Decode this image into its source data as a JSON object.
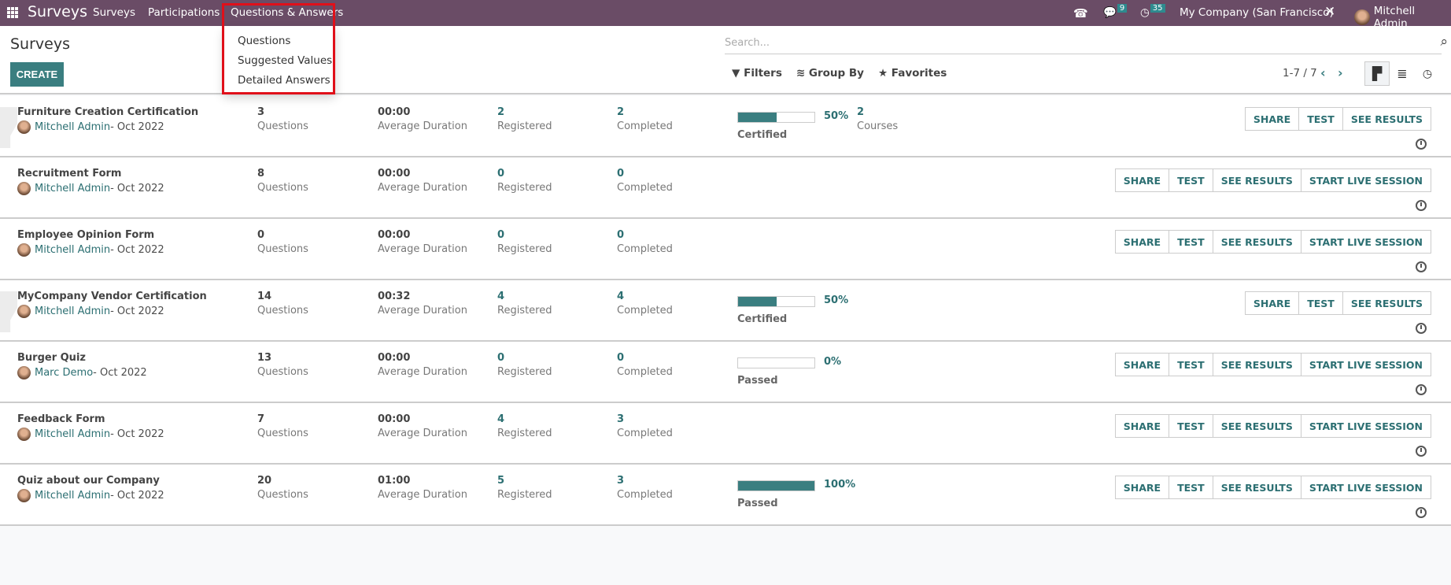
{
  "navbar": {
    "app_title": "Surveys",
    "menus": [
      "Surveys",
      "Participations",
      "Questions & Answers"
    ],
    "messages_count": "9",
    "activities_count": "35",
    "company": "My Company (San Francisco)",
    "user": "Mitchell Admin"
  },
  "dropdown": {
    "items": [
      "Questions",
      "Suggested Values",
      "Detailed Answers"
    ]
  },
  "control": {
    "title": "Surveys",
    "create_label": "CREATE",
    "search_placeholder": "Search...",
    "filters": "Filters",
    "group_by": "Group By",
    "favorites": "Favorites",
    "pager": "1-7 / 7"
  },
  "labels": {
    "questions": "Questions",
    "duration": "Average Duration",
    "registered": "Registered",
    "completed": "Completed",
    "courses": "Courses",
    "share": "SHARE",
    "test": "TEST",
    "see_results": "SEE RESULTS",
    "live": "START LIVE SESSION"
  },
  "accent": "#3a7e80",
  "surveys": [
    {
      "name": "Furniture Creation Certification",
      "owner": "Mitchell Admin",
      "date": " - Oct 2022",
      "questions": "3",
      "duration": "00:00",
      "registered": "2",
      "completed": "2",
      "progress": 50,
      "progress_label": "50%",
      "progress_type": "Certified",
      "courses": "2",
      "live": false,
      "ghost": true
    },
    {
      "name": "Recruitment Form",
      "owner": "Mitchell Admin",
      "date": " - Oct 2022",
      "questions": "8",
      "duration": "00:00",
      "registered": "0",
      "completed": "0",
      "live": true
    },
    {
      "name": "Employee Opinion Form",
      "owner": "Mitchell Admin",
      "date": " - Oct 2022",
      "questions": "0",
      "duration": "00:00",
      "registered": "0",
      "completed": "0",
      "live": true
    },
    {
      "name": "MyCompany Vendor Certification",
      "owner": "Mitchell Admin",
      "date": " - Oct 2022",
      "questions": "14",
      "duration": "00:32",
      "registered": "4",
      "completed": "4",
      "progress": 50,
      "progress_label": "50%",
      "progress_type": "Certified",
      "live": false,
      "ghost": true
    },
    {
      "name": "Burger Quiz",
      "owner": "Marc Demo",
      "date": " - Oct 2022",
      "questions": "13",
      "duration": "00:00",
      "registered": "0",
      "completed": "0",
      "progress": 0,
      "progress_label": "0%",
      "progress_type": "Passed",
      "live": true
    },
    {
      "name": "Feedback Form",
      "owner": "Mitchell Admin",
      "date": " - Oct 2022",
      "questions": "7",
      "duration": "00:00",
      "registered": "4",
      "completed": "3",
      "live": true
    },
    {
      "name": "Quiz about our Company",
      "owner": "Mitchell Admin",
      "date": " - Oct 2022",
      "questions": "20",
      "duration": "01:00",
      "registered": "5",
      "completed": "3",
      "progress": 100,
      "progress_label": "100%",
      "progress_type": "Passed",
      "live": true
    }
  ]
}
